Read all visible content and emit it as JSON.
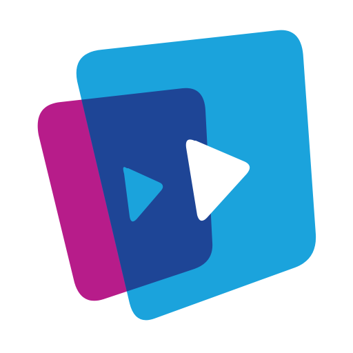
{
  "icon": {
    "name": "media-player-app-logo",
    "background_color": "#ffffff",
    "colors": {
      "magenta_card": "#B71C8A",
      "navy_overlap": "#1E4596",
      "blue_card": "#1BA3DC",
      "small_play_triangle": "#1BA3DC",
      "large_play_triangle": "#ffffff"
    },
    "elements": [
      "magenta-back-card",
      "blue-front-card",
      "navy-overlap-region",
      "small-play-icon",
      "large-play-icon"
    ]
  }
}
